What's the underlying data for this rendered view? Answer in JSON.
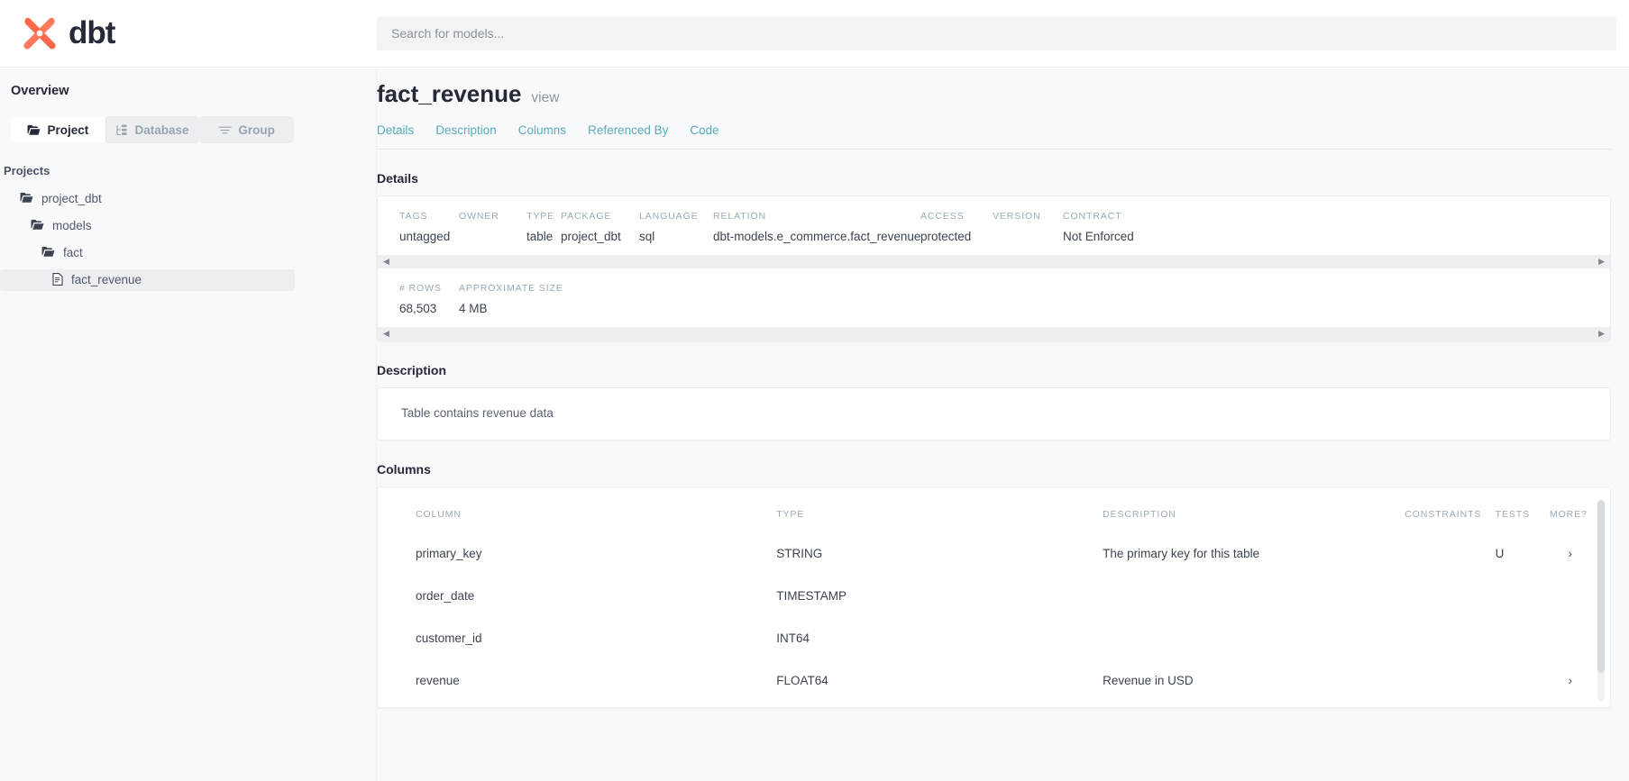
{
  "header": {
    "logo_text": "dbt",
    "logo_icon": "dbt-x-logo-icon",
    "search_placeholder": "Search for models...",
    "search_value": "",
    "accent_orange": "#ff694a",
    "logo_navy": "#262a38"
  },
  "sidebar": {
    "overview_label": "Overview",
    "tabs": [
      {
        "label": "Project",
        "icon": "folder-icon",
        "active": true
      },
      {
        "label": "Database",
        "icon": "database-tree-icon",
        "active": false
      },
      {
        "label": "Group",
        "icon": "group-lines-icon",
        "active": false
      }
    ],
    "projects_label": "Projects",
    "tree": [
      {
        "label": "project_dbt",
        "icon": "folder-icon",
        "depth": 1,
        "selected": false
      },
      {
        "label": "models",
        "icon": "folder-icon",
        "depth": 2,
        "selected": false
      },
      {
        "label": "fact",
        "icon": "folder-icon",
        "depth": 3,
        "selected": false
      },
      {
        "label": "fact_revenue",
        "icon": "file-document-icon",
        "depth": 4,
        "selected": true
      }
    ]
  },
  "main": {
    "title": "fact_revenue",
    "subtitle": "view",
    "anchors": [
      "Details",
      "Description",
      "Columns",
      "Referenced By",
      "Code"
    ],
    "details": {
      "section_title": "Details",
      "row1": [
        {
          "header": "TAGS",
          "value": "untagged"
        },
        {
          "header": "OWNER",
          "value": ""
        },
        {
          "header": "TYPE",
          "value": "table"
        },
        {
          "header": "PACKAGE",
          "value": "project_dbt"
        },
        {
          "header": "LANGUAGE",
          "value": "sql"
        },
        {
          "header": "RELATION",
          "value": "dbt-models.e_commerce.fact_revenue"
        },
        {
          "header": "ACCESS",
          "value": "protected"
        },
        {
          "header": "VERSION",
          "value": ""
        },
        {
          "header": "CONTRACT",
          "value": "Not Enforced"
        }
      ],
      "row2": [
        {
          "header": "# ROWS",
          "value": "68,503"
        },
        {
          "header": "APPROXIMATE SIZE",
          "value": "4 MB"
        }
      ],
      "scroll_left_icon": "scroll-left-arrow-icon",
      "scroll_right_icon": "scroll-right-arrow-icon"
    },
    "description": {
      "section_title": "Description",
      "body": "Table contains revenue data"
    },
    "columns": {
      "section_title": "Columns",
      "headers": [
        "COLUMN",
        "TYPE",
        "DESCRIPTION",
        "CONSTRAINTS",
        "TESTS",
        "MORE?"
      ],
      "rows": [
        {
          "column": "primary_key",
          "type": "STRING",
          "description": "The primary key for this table",
          "constraints": "",
          "tests": "U",
          "more": "›"
        },
        {
          "column": "order_date",
          "type": "TIMESTAMP",
          "description": "",
          "constraints": "",
          "tests": "",
          "more": ""
        },
        {
          "column": "customer_id",
          "type": "INT64",
          "description": "",
          "constraints": "",
          "tests": "",
          "more": ""
        },
        {
          "column": "revenue",
          "type": "FLOAT64",
          "description": "Revenue in USD",
          "constraints": "",
          "tests": "",
          "more": "›"
        }
      ]
    }
  }
}
